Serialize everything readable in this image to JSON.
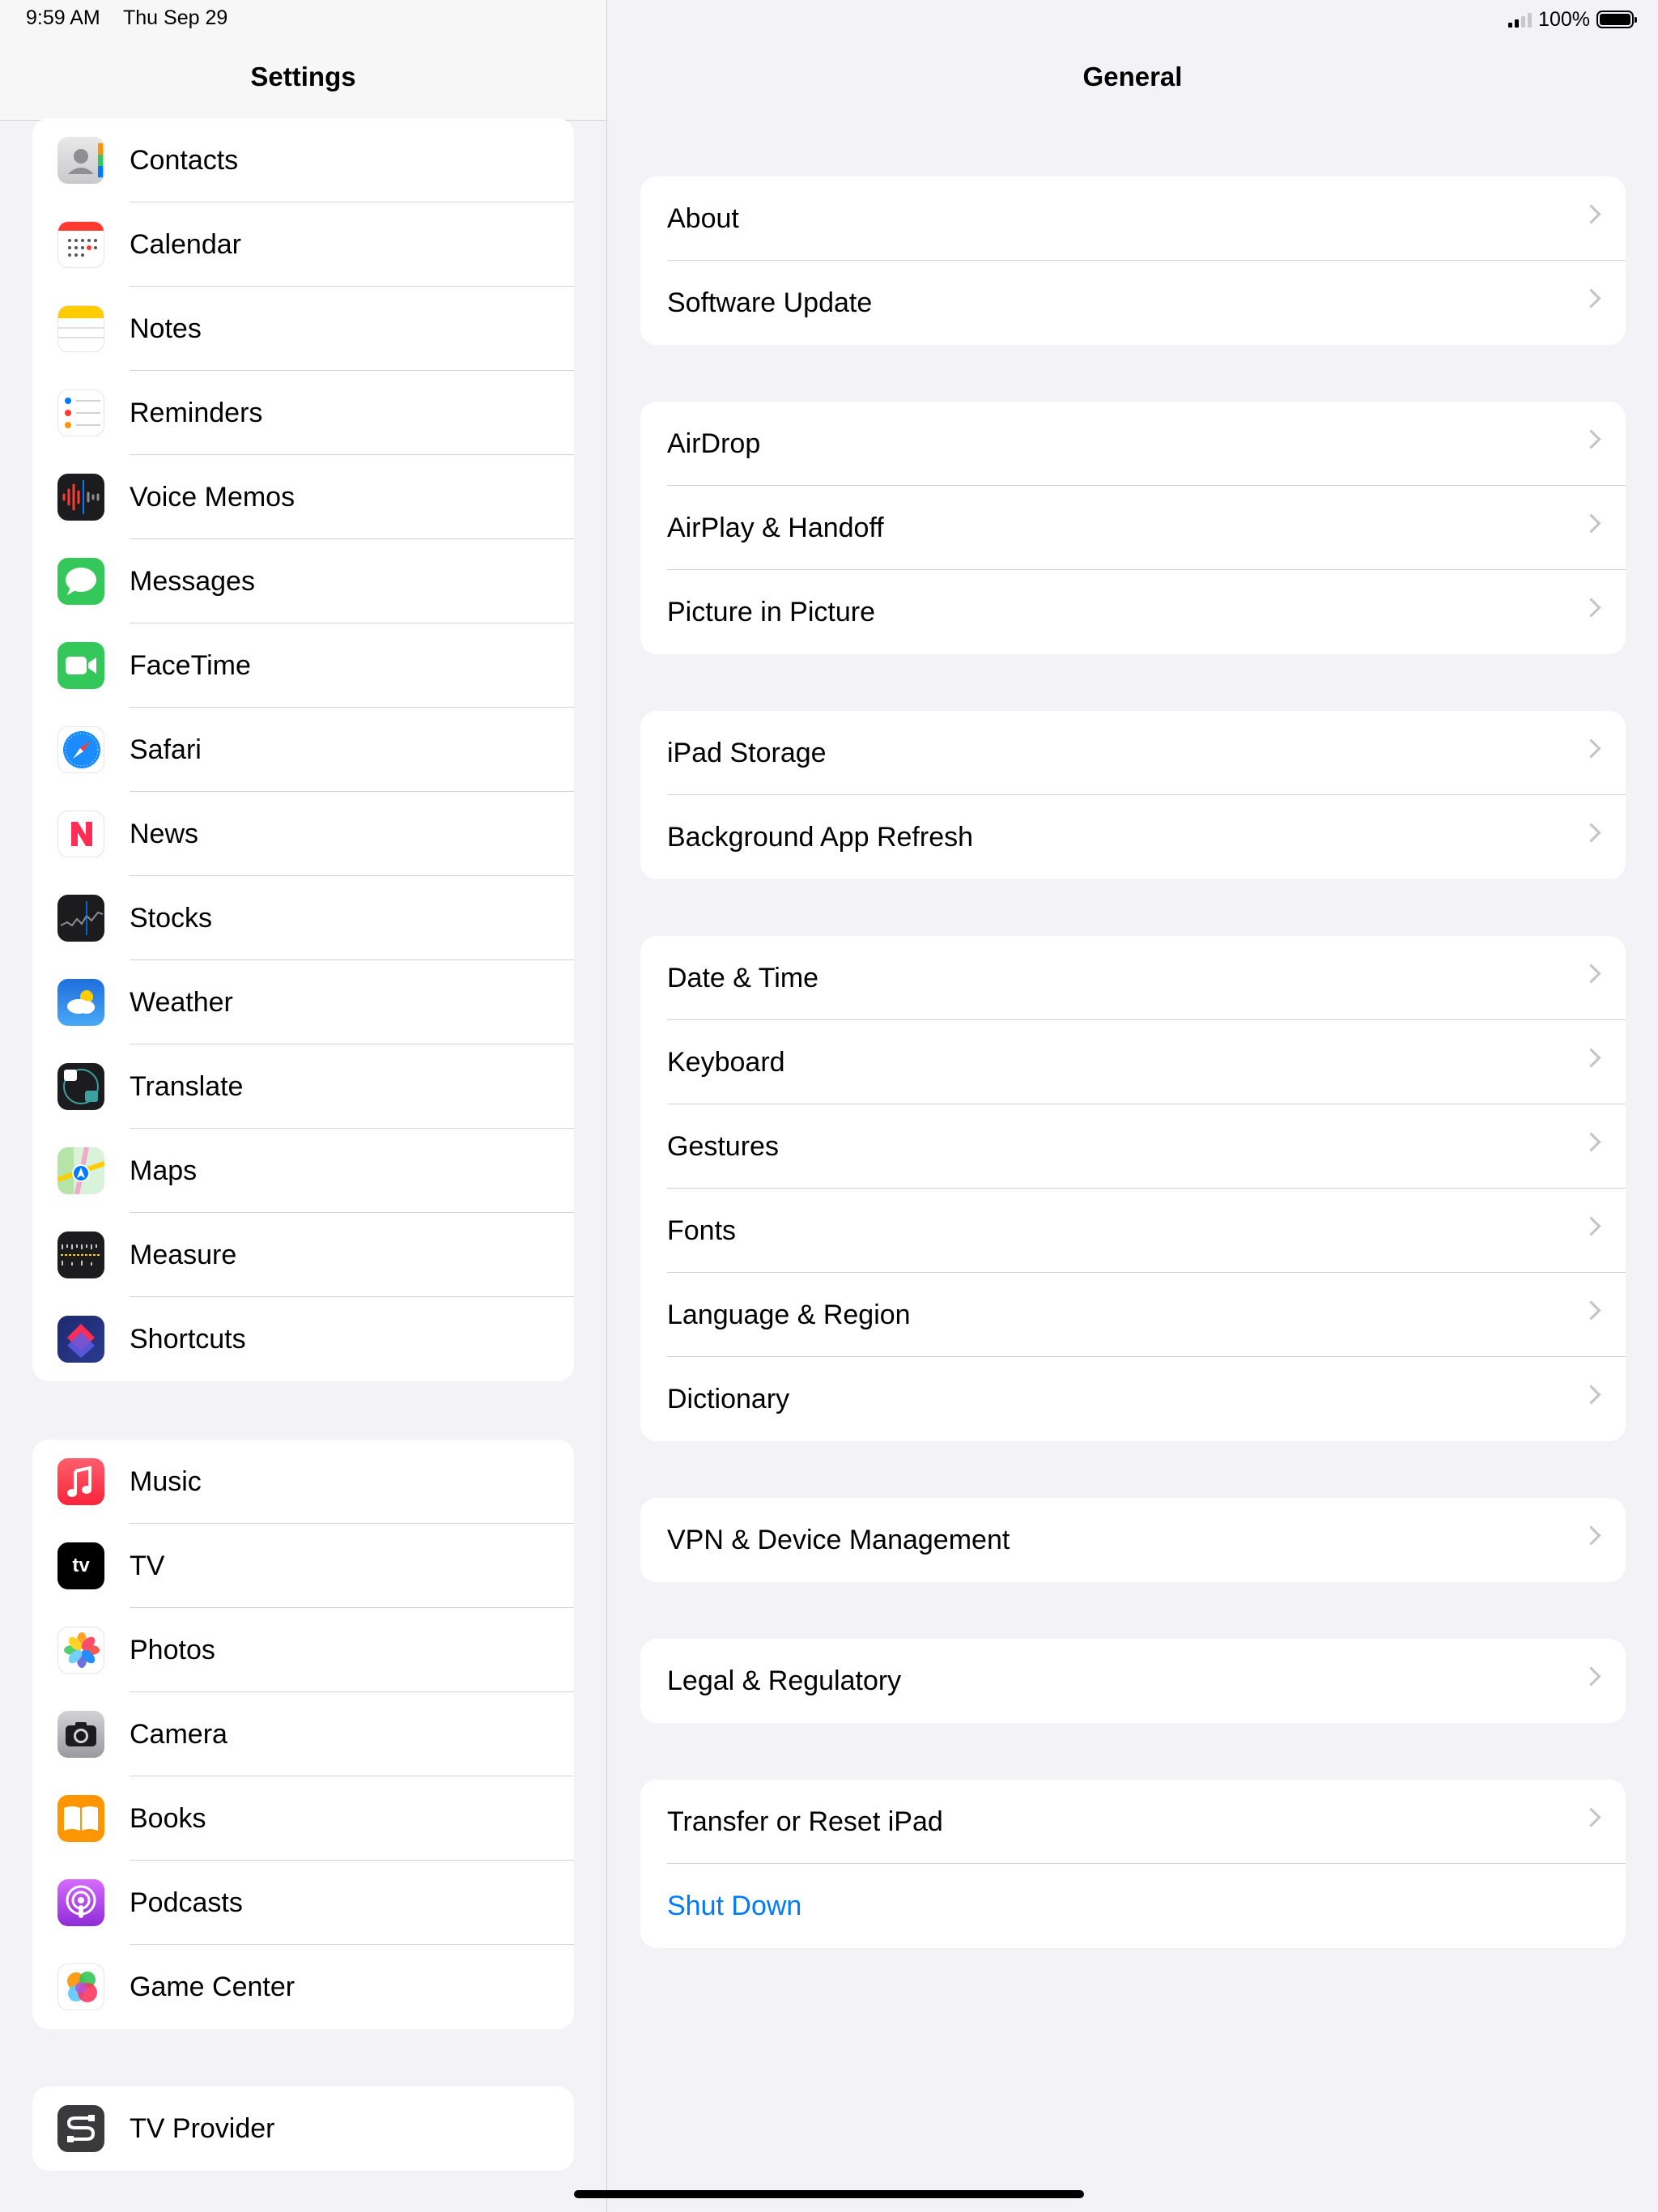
{
  "status_bar": {
    "time": "9:59 AM",
    "date": "Thu Sep 29",
    "battery": "100%"
  },
  "sidebar": {
    "title": "Settings",
    "groups": [
      [
        {
          "label": "Contacts",
          "icon": "contacts-icon"
        },
        {
          "label": "Calendar",
          "icon": "calendar-icon"
        },
        {
          "label": "Notes",
          "icon": "notes-icon"
        },
        {
          "label": "Reminders",
          "icon": "reminders-icon"
        },
        {
          "label": "Voice Memos",
          "icon": "voice-memos-icon"
        },
        {
          "label": "Messages",
          "icon": "messages-icon"
        },
        {
          "label": "FaceTime",
          "icon": "facetime-icon"
        },
        {
          "label": "Safari",
          "icon": "safari-icon"
        },
        {
          "label": "News",
          "icon": "news-icon"
        },
        {
          "label": "Stocks",
          "icon": "stocks-icon"
        },
        {
          "label": "Weather",
          "icon": "weather-icon"
        },
        {
          "label": "Translate",
          "icon": "translate-icon"
        },
        {
          "label": "Maps",
          "icon": "maps-icon"
        },
        {
          "label": "Measure",
          "icon": "measure-icon"
        },
        {
          "label": "Shortcuts",
          "icon": "shortcuts-icon"
        }
      ],
      [
        {
          "label": "Music",
          "icon": "music-icon"
        },
        {
          "label": "TV",
          "icon": "tv-icon"
        },
        {
          "label": "Photos",
          "icon": "photos-icon"
        },
        {
          "label": "Camera",
          "icon": "camera-icon"
        },
        {
          "label": "Books",
          "icon": "books-icon"
        },
        {
          "label": "Podcasts",
          "icon": "podcasts-icon"
        },
        {
          "label": "Game Center",
          "icon": "game-center-icon"
        }
      ],
      [
        {
          "label": "TV Provider",
          "icon": "tv-provider-icon"
        }
      ]
    ]
  },
  "detail": {
    "title": "General",
    "groups": [
      [
        {
          "label": "About"
        },
        {
          "label": "Software Update"
        }
      ],
      [
        {
          "label": "AirDrop"
        },
        {
          "label": "AirPlay & Handoff"
        },
        {
          "label": "Picture in Picture"
        }
      ],
      [
        {
          "label": "iPad Storage"
        },
        {
          "label": "Background App Refresh"
        }
      ],
      [
        {
          "label": "Date & Time"
        },
        {
          "label": "Keyboard"
        },
        {
          "label": "Gestures"
        },
        {
          "label": "Fonts"
        },
        {
          "label": "Language & Region"
        },
        {
          "label": "Dictionary"
        }
      ],
      [
        {
          "label": "VPN & Device Management"
        }
      ],
      [
        {
          "label": "Legal & Regulatory"
        }
      ],
      [
        {
          "label": "Transfer or Reset iPad"
        },
        {
          "label": "Shut Down",
          "accent": "#007aff"
        }
      ]
    ]
  },
  "icon_glyphs": {
    "tv": "tv"
  }
}
